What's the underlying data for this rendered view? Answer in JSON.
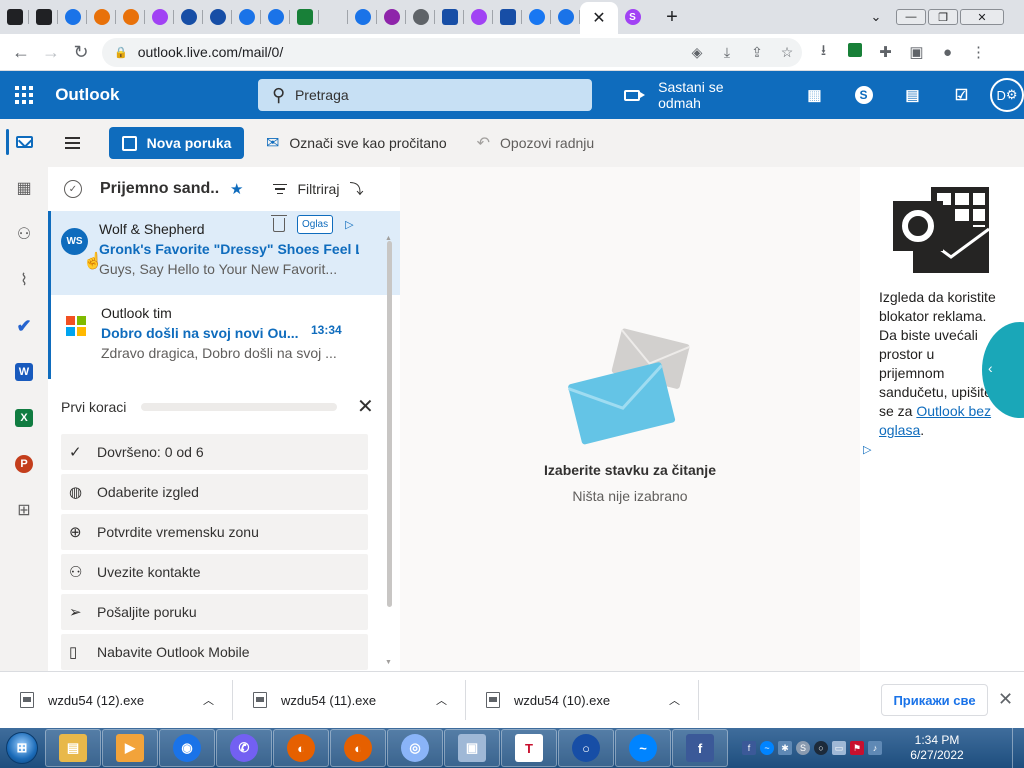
{
  "browser": {
    "url": "outlook.live.com/mail/0/",
    "tabs": [
      {
        "icon": "phone-icon",
        "color": "#202124"
      },
      {
        "icon": "phone-icon",
        "color": "#202124"
      },
      {
        "icon": "edge-icon",
        "color": "#1a73e8"
      },
      {
        "icon": "rainbow-icon",
        "color": "#e8710a"
      },
      {
        "icon": "rainbow-icon",
        "color": "#e8710a"
      },
      {
        "icon": "chat-icon",
        "color": "#a142f4"
      },
      {
        "icon": "shield-icon",
        "color": "#174ea6"
      },
      {
        "icon": "shield-icon",
        "color": "#174ea6"
      },
      {
        "icon": "edge-icon",
        "color": "#1a73e8"
      },
      {
        "icon": "edge-icon",
        "color": "#1a73e8"
      },
      {
        "icon": "puzzle-icon",
        "color": "#188038"
      },
      {
        "icon": "blank-icon",
        "color": "#dee1e6"
      },
      {
        "icon": "edge-icon",
        "color": "#1a73e8"
      },
      {
        "icon": "info-icon",
        "color": "#8e24aa"
      },
      {
        "icon": "globe-icon",
        "color": "#5f6368"
      },
      {
        "icon": "search-square-icon",
        "color": "#174ea6"
      },
      {
        "icon": "messenger-icon",
        "color": "#a142f4"
      },
      {
        "icon": "search-square-icon",
        "color": "#174ea6"
      },
      {
        "icon": "facebook-icon",
        "color": "#1877f2"
      },
      {
        "icon": "k-icon",
        "color": "#1a73e8"
      }
    ],
    "active_tab_close": "✕",
    "new_tab": "+"
  },
  "header": {
    "brand": "Outlook",
    "search_placeholder": "Pretraga",
    "meet_now": "Sastani se odmah",
    "avatar_initials": "D"
  },
  "commands": {
    "new_message": "Nova poruka",
    "mark_all_read": "Označi sve kao pročitano",
    "undo": "Opozovi radnju"
  },
  "list": {
    "folder": "Prijemno sand...",
    "filter": "Filtriraj",
    "messages": [
      {
        "initials": "WS",
        "sender": "Wolf & Shepherd",
        "subject": "Gronk's Favorite \"Dressy\" Shoes Feel Li...",
        "preview": "Guys, Say Hello to Your New Favorit...",
        "ad_label": "Oglas"
      },
      {
        "sender": "Outlook tim",
        "subject": "Dobro došli na svoj novi Ou...",
        "time": "13:34",
        "preview": "Zdravo dragica, Dobro došli na svoj ..."
      }
    ]
  },
  "first_steps": {
    "title": "Prvi koraci",
    "progress": 0,
    "items": [
      {
        "icon": "check-icon",
        "label": "Dovršeno: 0 od 6"
      },
      {
        "icon": "palette-icon",
        "label": "Odaberite izgled"
      },
      {
        "icon": "globe-icon",
        "label": "Potvrdite vremensku zonu"
      },
      {
        "icon": "people-icon",
        "label": "Uvezite kontakte"
      },
      {
        "icon": "send-icon",
        "label": "Pošaljite poruku"
      },
      {
        "icon": "mobile-icon",
        "label": "Nabavite Outlook Mobile"
      }
    ]
  },
  "reading": {
    "title": "Izaberite stavku za čitanje",
    "subtitle": "Ništa nije izabrano"
  },
  "ad": {
    "text": "Izgleda da koristite blokator reklama. Da biste uvećali prostor u prijemnom sandučetu, upišite se za ",
    "link": "Outlook bez oglasa",
    "end": "."
  },
  "downloads": {
    "items": [
      {
        "name": "wzdu54 (12).exe"
      },
      {
        "name": "wzdu54 (11).exe"
      },
      {
        "name": "wzdu54 (10).exe"
      }
    ],
    "show_all": "Прикажи све"
  },
  "taskbar": {
    "time": "1:34 PM",
    "date": "6/27/2022",
    "apps": [
      {
        "icon": "folder-icon",
        "color": "#e8b84a"
      },
      {
        "icon": "media-player-icon",
        "color": "#f2a33a"
      },
      {
        "icon": "chrome-icon",
        "color": "#1a73e8"
      },
      {
        "icon": "viber-icon",
        "color": "#7360f2"
      },
      {
        "icon": "firefox-icon",
        "color": "#e66000"
      },
      {
        "icon": "firefox-icon",
        "color": "#e66000"
      },
      {
        "icon": "disc-icon",
        "color": "#8ab4f8"
      },
      {
        "icon": "computer-icon",
        "color": "#9fb8d6"
      },
      {
        "icon": "t-app-icon",
        "color": "#ffffff"
      },
      {
        "icon": "search-app-icon",
        "color": "#174ea6"
      },
      {
        "icon": "messenger-icon",
        "color": "#0084ff"
      },
      {
        "icon": "facebook-icon",
        "color": "#3b5998"
      }
    ]
  }
}
